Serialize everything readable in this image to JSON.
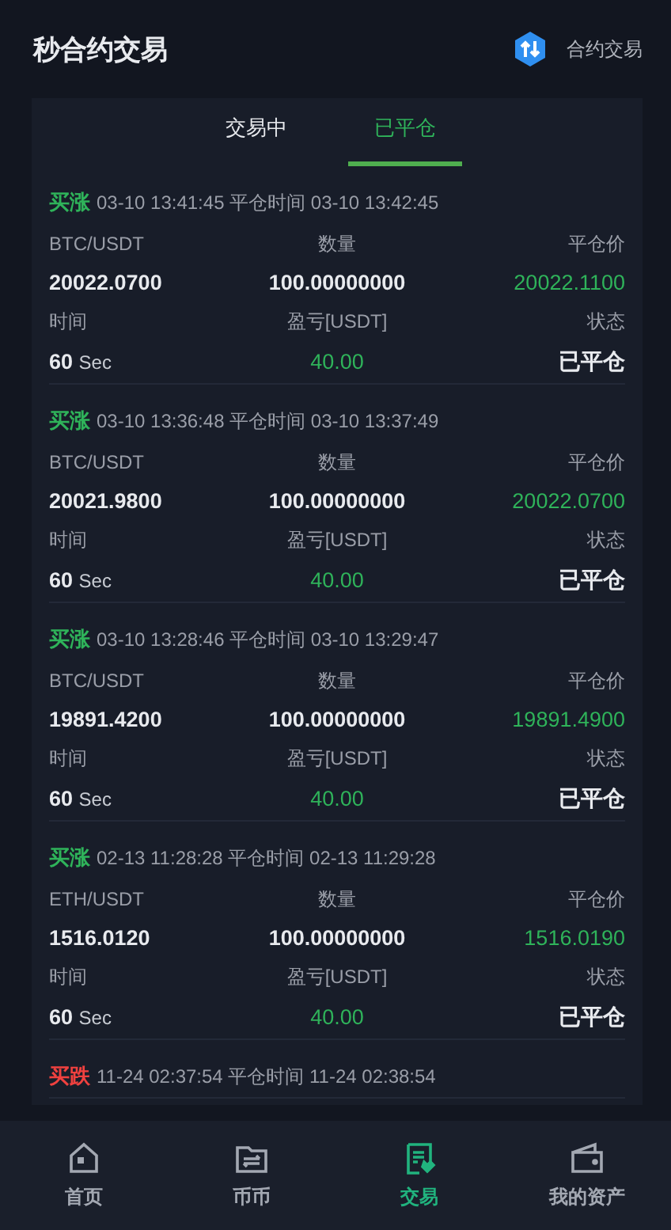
{
  "header": {
    "title": "秒合约交易",
    "link": "合约交易"
  },
  "tabs": [
    {
      "label": "交易中",
      "selected": false
    },
    {
      "label": "已平仓",
      "selected": true
    }
  ],
  "trades": [
    {
      "direction": "买涨",
      "kind": "up",
      "open_time": "03-10 13:41:45",
      "close_label": "平仓时间",
      "close_time": "03-10 13:42:45",
      "pair": "BTC/USDT",
      "price": "20022.0700",
      "qty_label": "数量",
      "qty": "100.00000000",
      "close_price_label": "平仓价",
      "close_price": "20022.1100",
      "time_label": "时间",
      "duration": "60",
      "unit": "Sec",
      "pnl_label": "盈亏[USDT]",
      "pnl": "40.00",
      "status_label": "状态",
      "status": "已平仓"
    },
    {
      "direction": "买涨",
      "kind": "up",
      "open_time": "03-10 13:36:48",
      "close_label": "平仓时间",
      "close_time": "03-10 13:37:49",
      "pair": "BTC/USDT",
      "price": "20021.9800",
      "qty_label": "数量",
      "qty": "100.00000000",
      "close_price_label": "平仓价",
      "close_price": "20022.0700",
      "time_label": "时间",
      "duration": "60",
      "unit": "Sec",
      "pnl_label": "盈亏[USDT]",
      "pnl": "40.00",
      "status_label": "状态",
      "status": "已平仓"
    },
    {
      "direction": "买涨",
      "kind": "up",
      "open_time": "03-10 13:28:46",
      "close_label": "平仓时间",
      "close_time": "03-10 13:29:47",
      "pair": "BTC/USDT",
      "price": "19891.4200",
      "qty_label": "数量",
      "qty": "100.00000000",
      "close_price_label": "平仓价",
      "close_price": "19891.4900",
      "time_label": "时间",
      "duration": "60",
      "unit": "Sec",
      "pnl_label": "盈亏[USDT]",
      "pnl": "40.00",
      "status_label": "状态",
      "status": "已平仓"
    },
    {
      "direction": "买涨",
      "kind": "up",
      "open_time": "02-13 11:28:28",
      "close_label": "平仓时间",
      "close_time": "02-13 11:29:28",
      "pair": "ETH/USDT",
      "price": "1516.0120",
      "qty_label": "数量",
      "qty": "100.00000000",
      "close_price_label": "平仓价",
      "close_price": "1516.0190",
      "time_label": "时间",
      "duration": "60",
      "unit": "Sec",
      "pnl_label": "盈亏[USDT]",
      "pnl": "40.00",
      "status_label": "状态",
      "status": "已平仓"
    },
    {
      "direction": "买跌",
      "kind": "down",
      "open_time": "11-24 02:37:54",
      "close_label": "平仓时间",
      "close_time": "11-24 02:38:54"
    }
  ],
  "nav": [
    {
      "label": "首页",
      "selected": false,
      "kind": "home"
    },
    {
      "label": "币币",
      "selected": false,
      "kind": "exchange"
    },
    {
      "label": "交易",
      "selected": true,
      "kind": "trade"
    },
    {
      "label": "我的资产",
      "selected": false,
      "kind": "wallet"
    }
  ]
}
